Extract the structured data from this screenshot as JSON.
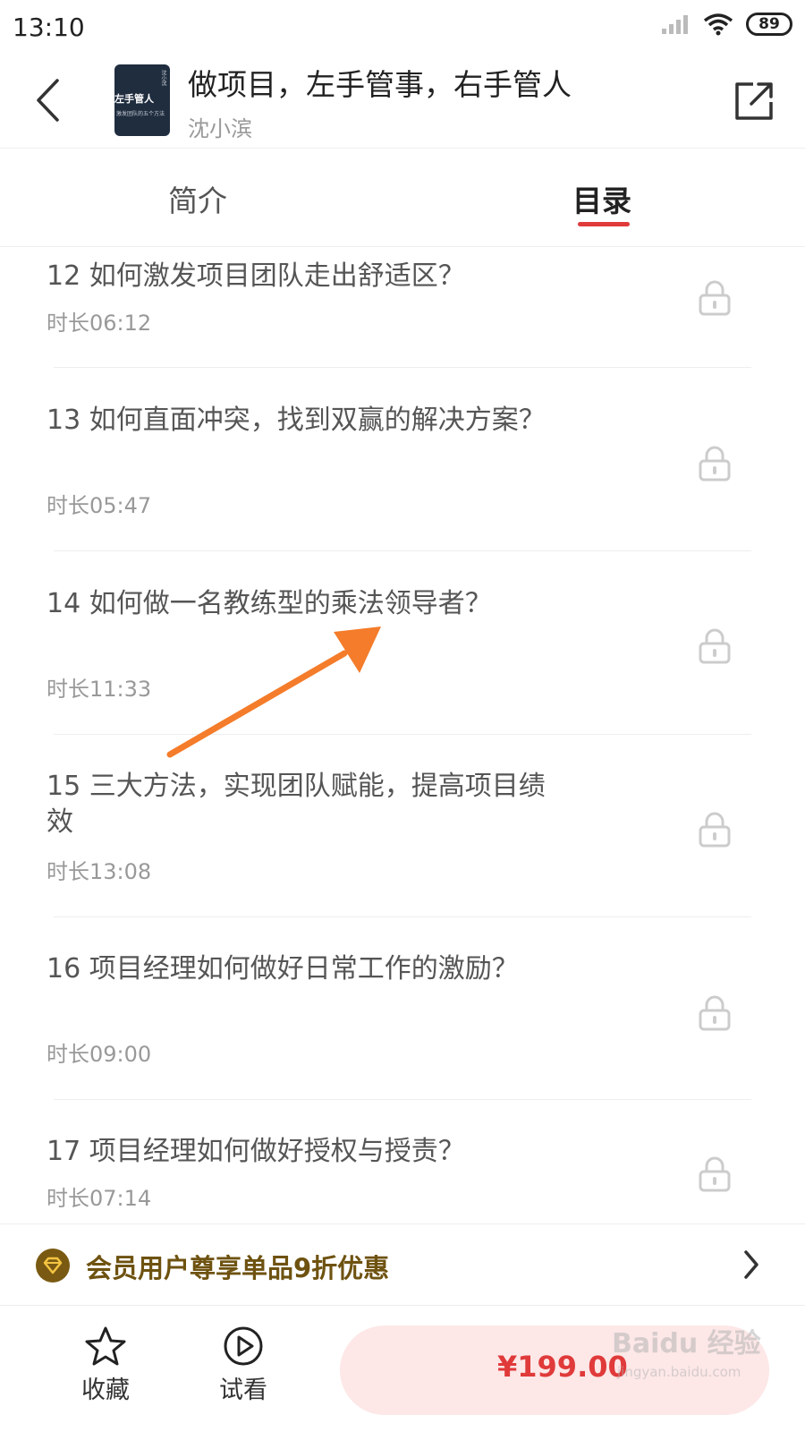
{
  "status_bar": {
    "time": "13:10",
    "battery": "89"
  },
  "header": {
    "back_icon": "chevron-left-icon",
    "cover_title": "左手管人",
    "cover_subtitle": "激发团队的五个方法",
    "cover_author": "沈小滨",
    "course_title": "做项目，左手管事，右手管人",
    "course_author": "沈小滨",
    "share_icon": "share-icon"
  },
  "tabs": [
    {
      "label": "简介",
      "active": false
    },
    {
      "label": "目录",
      "active": true
    }
  ],
  "accent_color": "#e03a3a",
  "chapters": [
    {
      "title": "12 如何激发项目团队走出舒适区？",
      "duration": "时长06:12",
      "locked": true
    },
    {
      "title": "13 如何直面冲突，找到双赢的解决方案？",
      "duration": "时长05:47",
      "locked": true
    },
    {
      "title": "14 如何做一名教练型的乘法领导者？",
      "duration": "时长11:33",
      "locked": true
    },
    {
      "title": "15 三大方法，实现团队赋能，提高项目绩效",
      "duration": "时长13:08",
      "locked": true
    },
    {
      "title": "16 项目经理如何做好日常工作的激励？",
      "duration": "时长09:00",
      "locked": true
    },
    {
      "title": "17 项目经理如何做好授权与授责？",
      "duration": "时长07:14",
      "locked": true
    }
  ],
  "member_banner": {
    "text": "会员用户尊享单品9折优惠",
    "color": "#6e5210"
  },
  "bottom_bar": {
    "favorite_label": "收藏",
    "trial_label": "试看",
    "price": "¥199.00"
  },
  "watermark": {
    "main": "Baidu 经验",
    "sub": "jingyan.baidu.com"
  }
}
